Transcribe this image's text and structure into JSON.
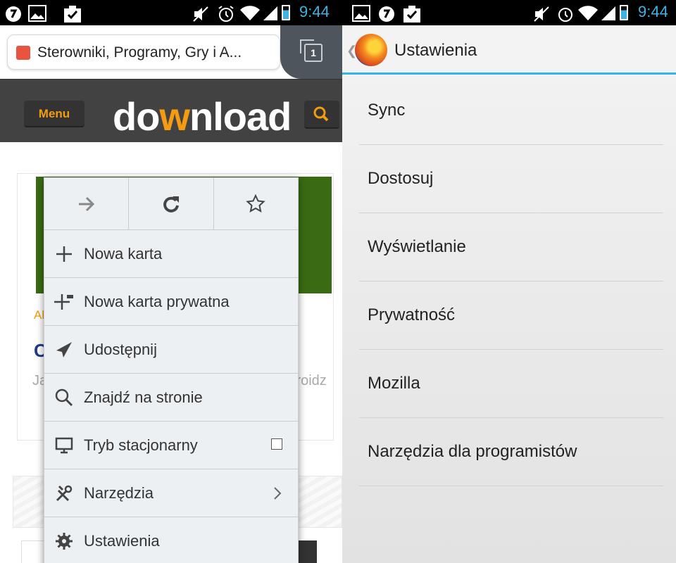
{
  "left_phone": {
    "status_time": "9:44",
    "tab_title": "Sterowniki, Programy, Gry i A...",
    "tabs_count": "1",
    "site_menu_label": "Menu",
    "logo": {
      "pre": "do",
      "mid": "w",
      "post": "nload"
    },
    "page_fragments": {
      "category_tag": "Ak",
      "heading": "C",
      "text_left": "Ja",
      "text_right": "lroidz"
    },
    "popup_menu": {
      "items": [
        {
          "label": "Nowa karta"
        },
        {
          "label": "Nowa karta prywatna"
        },
        {
          "label": "Udostępnij"
        },
        {
          "label": "Znajdź na stronie"
        },
        {
          "label": "Tryb stacjonarny"
        },
        {
          "label": "Narzędzia"
        },
        {
          "label": "Ustawienia"
        }
      ]
    }
  },
  "right_phone": {
    "status_time": "9:44",
    "title": "Ustawienia",
    "settings": [
      {
        "label": "Sync"
      },
      {
        "label": "Dostosuj"
      },
      {
        "label": "Wyświetlanie"
      },
      {
        "label": "Prywatność"
      },
      {
        "label": "Mozilla"
      },
      {
        "label": "Narzędzia dla programistów"
      }
    ]
  },
  "colors": {
    "accent": "#33b5e5",
    "site_orange": "#f39c12",
    "header_dark": "#424242"
  }
}
